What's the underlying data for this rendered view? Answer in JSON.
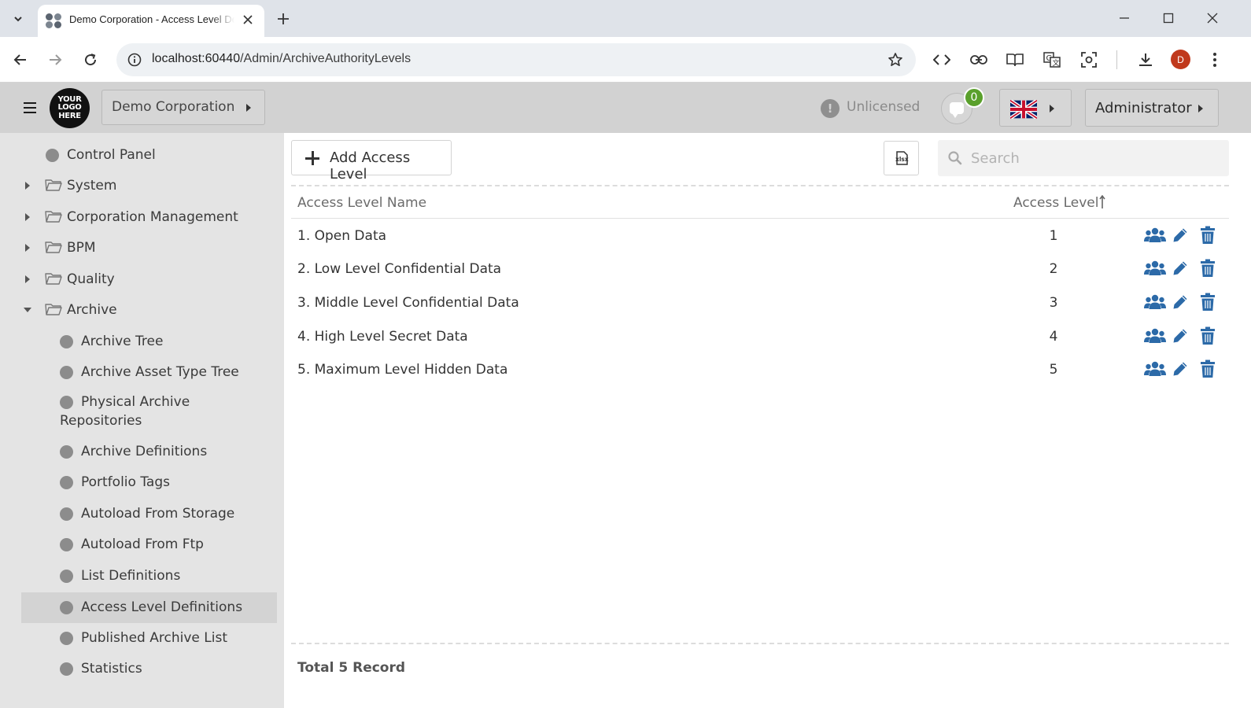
{
  "browser": {
    "tab_title": "Demo Corporation - Access Level Definitions",
    "url_host": "localhost:60440",
    "url_path": "/Admin/ArchiveAuthorityLevels",
    "profile_initial": "D"
  },
  "header": {
    "logo_text": "YOUR LOGO HERE",
    "company": "Demo Corporation",
    "license_status": "Unlicensed",
    "message_count": "0",
    "user": "Administrator"
  },
  "sidebar": {
    "items": [
      {
        "label": "Control Panel",
        "type": "leaf",
        "level": 0
      },
      {
        "label": "System",
        "type": "folder",
        "expanded": false
      },
      {
        "label": "Corporation Management",
        "type": "folder",
        "expanded": false
      },
      {
        "label": "BPM",
        "type": "folder",
        "expanded": false
      },
      {
        "label": "Quality",
        "type": "folder",
        "expanded": false
      },
      {
        "label": "Archive",
        "type": "folder",
        "expanded": true
      },
      {
        "label": "Archive Tree",
        "type": "leaf",
        "level": 1
      },
      {
        "label": "Archive Asset Type Tree",
        "type": "leaf",
        "level": 1
      },
      {
        "label": "Physical Archive",
        "label_line2": "Repositories",
        "type": "leaf",
        "level": 1
      },
      {
        "label": "Archive Definitions",
        "type": "leaf",
        "level": 1
      },
      {
        "label": "Portfolio Tags",
        "type": "leaf",
        "level": 1
      },
      {
        "label": "Autoload From Storage",
        "type": "leaf",
        "level": 1
      },
      {
        "label": "Autoload From Ftp",
        "type": "leaf",
        "level": 1
      },
      {
        "label": "List Definitions",
        "type": "leaf",
        "level": 1
      },
      {
        "label": "Access Level Definitions",
        "type": "leaf",
        "level": 1,
        "selected": true
      },
      {
        "label": "Published Archive List",
        "type": "leaf",
        "level": 1
      },
      {
        "label": "Statistics",
        "type": "leaf",
        "level": 1
      }
    ]
  },
  "main": {
    "add_button_label": "Add Access Level",
    "export_icon": "xlsx-export-icon",
    "search_placeholder": "Search",
    "columns": {
      "name": "Access Level Name",
      "level": "Access Level"
    },
    "sort": "ascending",
    "rows": [
      {
        "name": "1. Open Data",
        "level": "1"
      },
      {
        "name": "2. Low Level Confidential Data",
        "level": "2"
      },
      {
        "name": "3. Middle Level Confidential Data",
        "level": "3"
      },
      {
        "name": "4. High Level Secret Data",
        "level": "4"
      },
      {
        "name": "5. Maximum Level Hidden Data",
        "level": "5"
      }
    ],
    "row_action_icons": [
      "users-icon",
      "edit-icon",
      "trash-icon"
    ],
    "total_text": "Total 5 Record"
  },
  "colors": {
    "action_blue": "#2c6aa8",
    "badge_green": "#5aa02c",
    "profile_red": "#c0391c",
    "sidebar_bg": "#e4e4e4",
    "header_bg": "#d2d2d2"
  }
}
